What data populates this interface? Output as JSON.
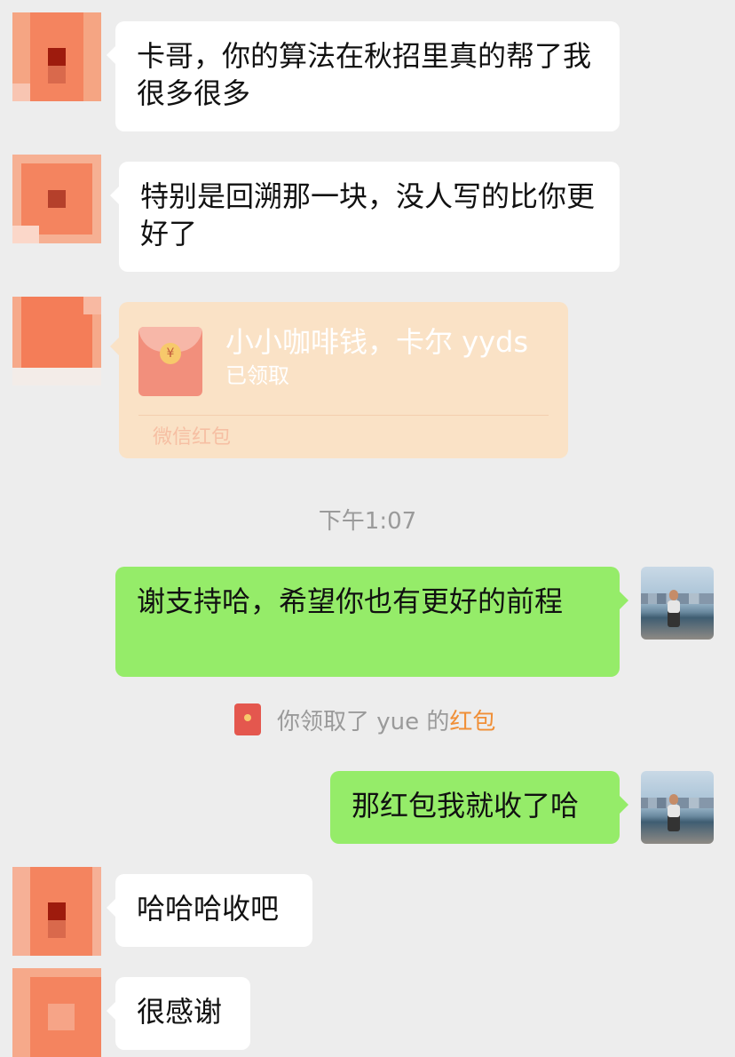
{
  "messages": [
    {
      "side": "left",
      "text": "卡哥，你的算法在秋招里真的帮了我很多很多"
    },
    {
      "side": "left",
      "text": "特别是回溯那一块，没人写的比你更好了"
    },
    {
      "side": "right",
      "text": "谢支持哈，希望你也有更好的前程"
    },
    {
      "side": "right",
      "text": "那红包我就收了哈"
    },
    {
      "side": "left",
      "text": "哈哈哈收吧"
    },
    {
      "side": "left",
      "text": "很感谢"
    }
  ],
  "red_packet": {
    "title": "小小咖啡钱，卡尔 yyds",
    "status": "已领取",
    "footer": "微信红包",
    "coin_symbol": "¥"
  },
  "time_separator": "下午1:07",
  "system_note": {
    "prefix": "你领取了 yue 的",
    "link": "红包"
  },
  "colors": {
    "background": "#ededed",
    "bubble_left": "#ffffff",
    "bubble_right": "#95ec69",
    "red_packet_received": "#fae2c6",
    "link_orange": "#f08f37"
  },
  "icons": {
    "red_packet_icon": "red-envelope-icon"
  }
}
